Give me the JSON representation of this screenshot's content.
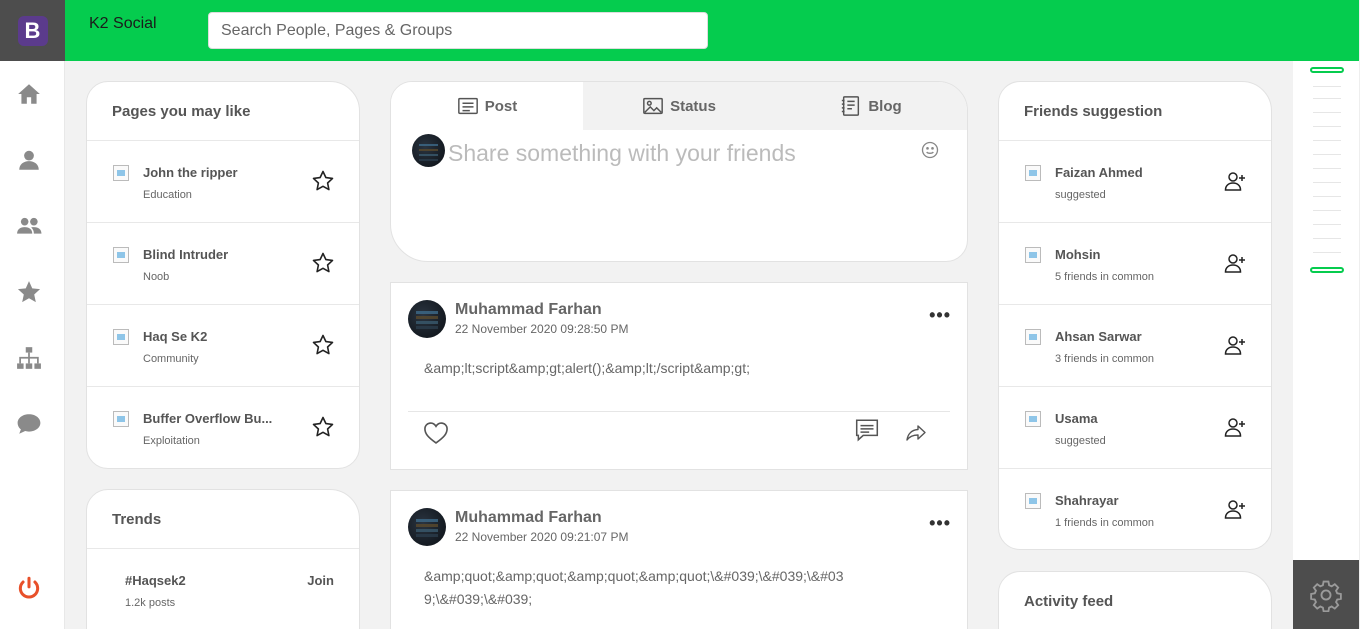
{
  "brand": {
    "letter": "B"
  },
  "header": {
    "app_title": "K2 Social",
    "search_placeholder": "Search People, Pages & Groups"
  },
  "nav": [
    "home-icon",
    "user-icon",
    "users-icon",
    "star-icon",
    "sitemap-icon",
    "chat-icon",
    "power-icon"
  ],
  "pages_card": {
    "title": "Pages you may like",
    "items": [
      {
        "name": "John the ripper",
        "category": "Education"
      },
      {
        "name": "Blind Intruder",
        "category": "Noob"
      },
      {
        "name": "Haq Se K2",
        "category": "Community"
      },
      {
        "name": "Buffer Overflow Bu...",
        "category": "Exploitation"
      }
    ]
  },
  "trends_card": {
    "title": "Trends",
    "items": [
      {
        "tag": "#Haqsek2",
        "posts": "1.2k posts",
        "action": "Join"
      }
    ]
  },
  "composer": {
    "tabs": [
      {
        "label": "Post"
      },
      {
        "label": "Status"
      },
      {
        "label": "Blog"
      }
    ],
    "placeholder": "Share something with your friends"
  },
  "posts": [
    {
      "author": "Muhammad Farhan",
      "time": "22 November 2020 09:28:50 PM",
      "body": "&amp;lt;script&amp;gt;alert();&amp;lt;/script&amp;gt;"
    },
    {
      "author": "Muhammad Farhan",
      "time": "22 November 2020 09:21:07 PM",
      "body_line1": "&amp;quot;&amp;quot;&amp;quot;&amp;quot;\\&#039;\\&#039;\\&#03",
      "body_line2": "9;\\&#039;\\&#039;"
    }
  ],
  "friends_card": {
    "title": "Friends suggestion",
    "items": [
      {
        "name": "Faizan Ahmed",
        "info": "suggested"
      },
      {
        "name": "Mohsin",
        "info": "5 friends in common"
      },
      {
        "name": "Ahsan Sarwar",
        "info": "3 friends in common"
      },
      {
        "name": "Usama",
        "info": "suggested"
      },
      {
        "name": "Shahrayar",
        "info": "1 friends in common"
      }
    ]
  },
  "activity_card": {
    "title": "Activity feed"
  },
  "colors": {
    "header": "#05cc4e",
    "brand": "#5b3b8c",
    "power": "#e8502a",
    "sidebar_dark": "#4d4d4d"
  }
}
